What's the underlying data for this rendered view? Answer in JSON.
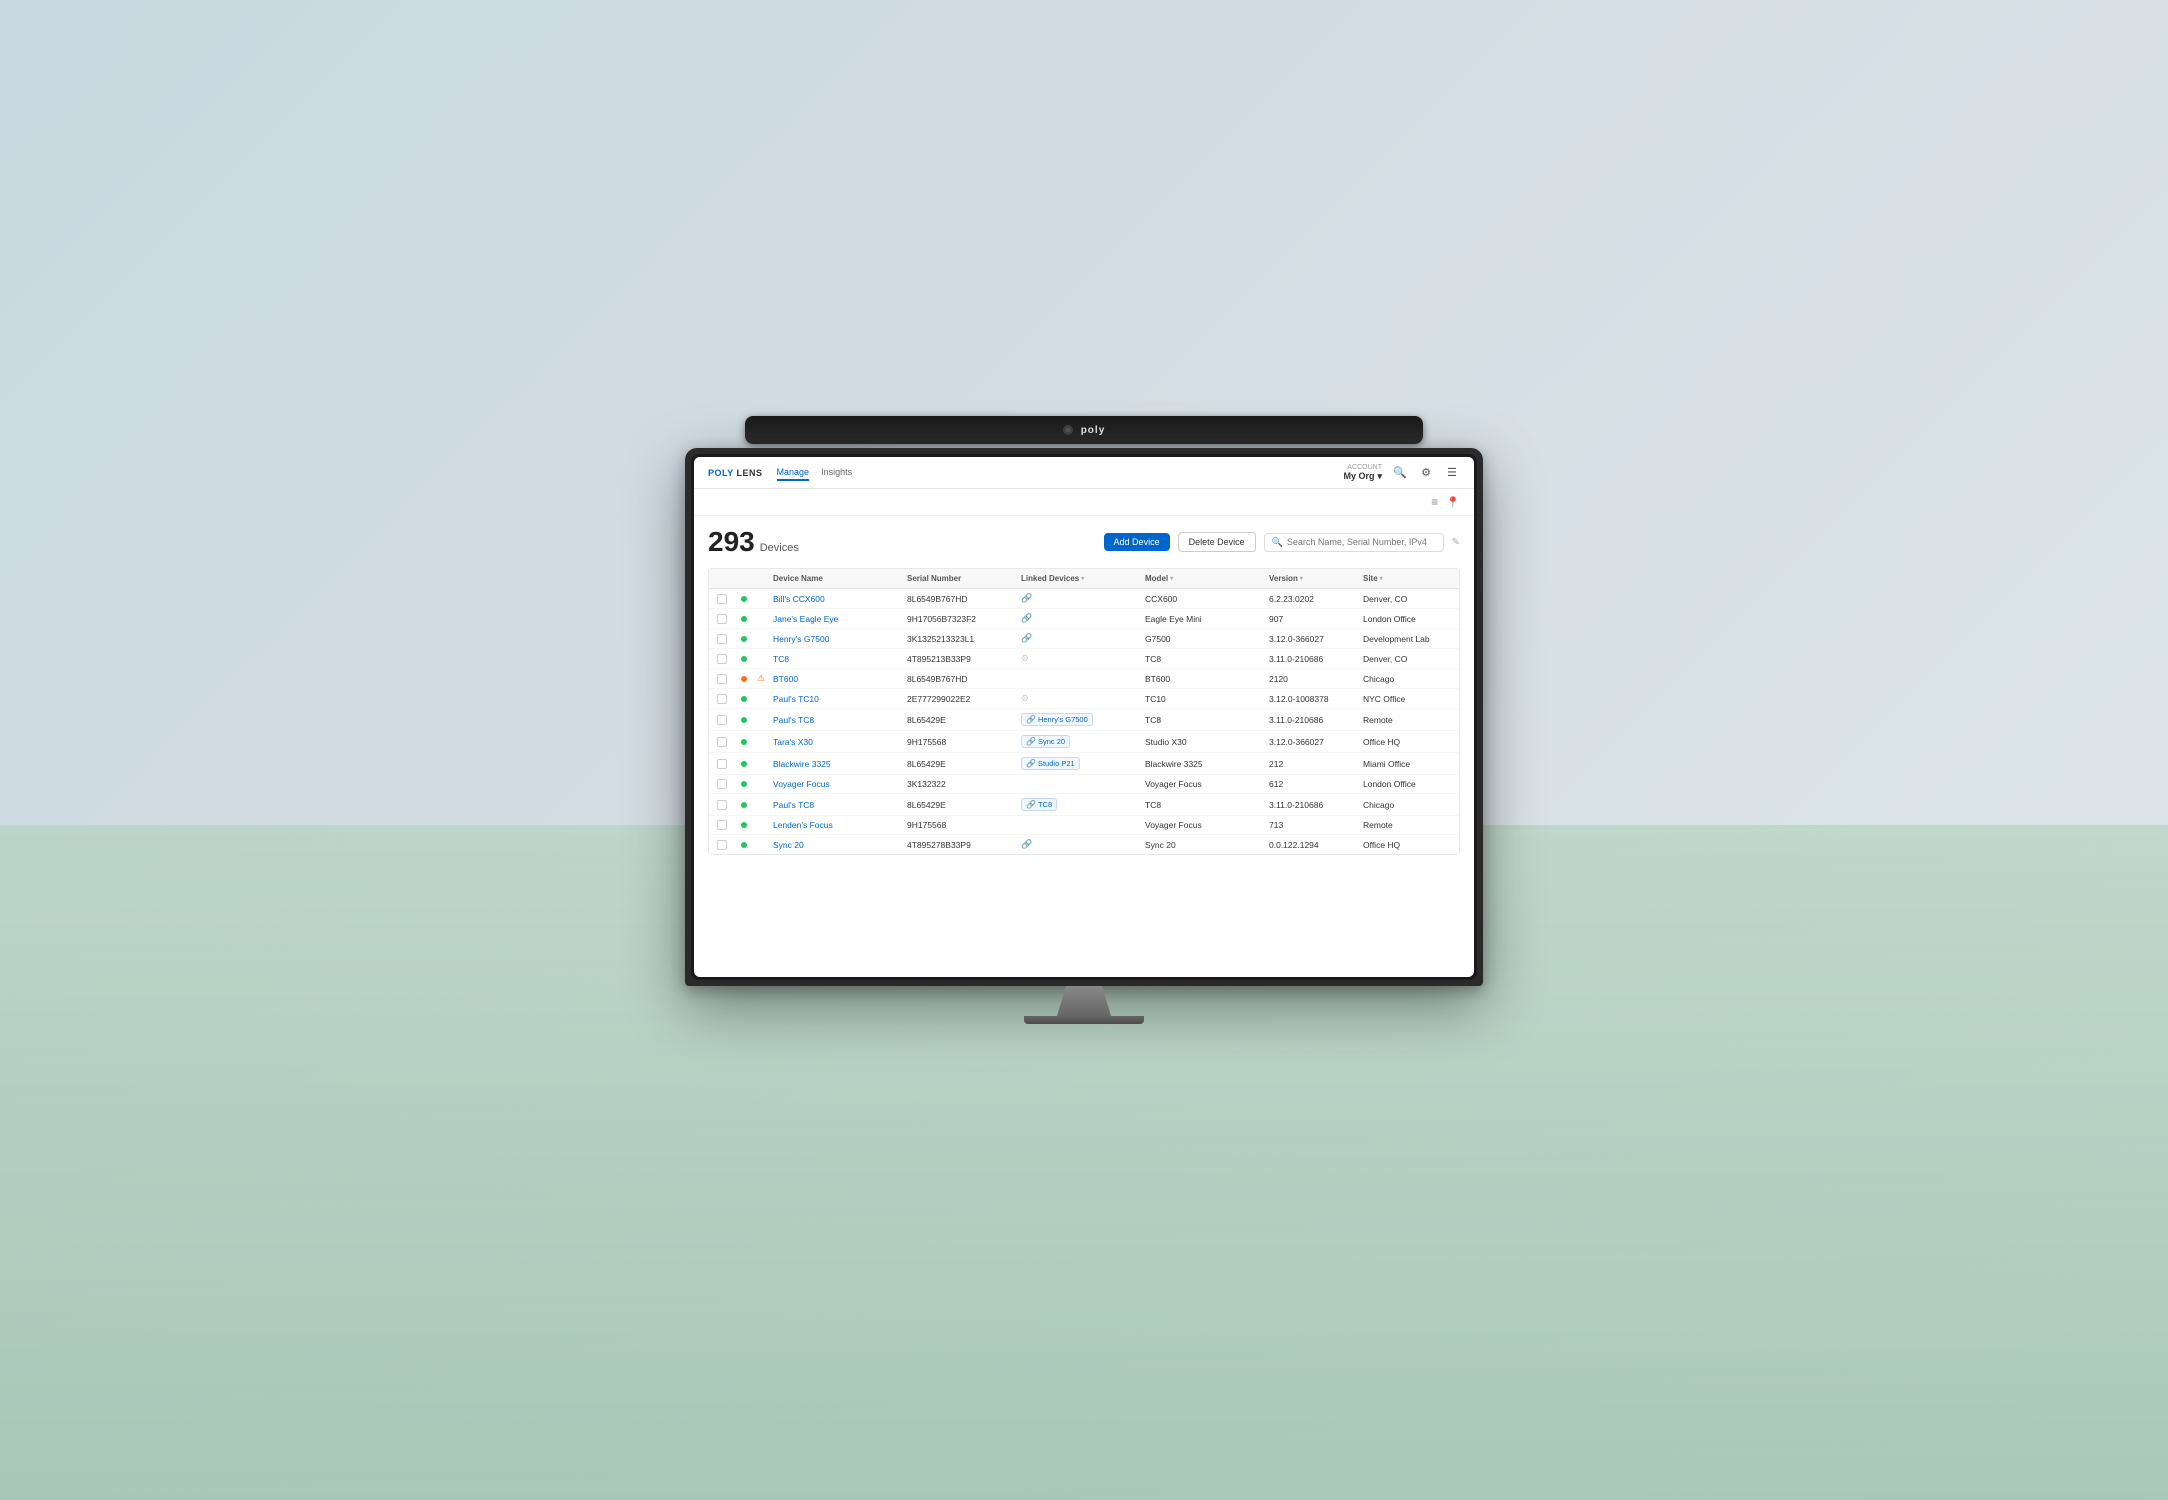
{
  "app": {
    "logo": "POLY LENS",
    "nav_tabs": [
      {
        "label": "Manage",
        "active": true
      },
      {
        "label": "Insights",
        "active": false
      }
    ],
    "account": {
      "label": "ACCOUNT",
      "name": "My Org",
      "chevron": "▾"
    },
    "nav_icons": {
      "search": "🔍",
      "settings": "⚙",
      "menu": "☰"
    }
  },
  "toolbar": {
    "filter_icon": "≡",
    "location_icon": "📍"
  },
  "page": {
    "device_count": "293",
    "device_label": "Devices",
    "add_button": "Add Device",
    "delete_button": "Delete Device",
    "search_placeholder": "Search Name, Serial Number, IPv4"
  },
  "table": {
    "columns": [
      {
        "id": "checkbox",
        "label": ""
      },
      {
        "id": "status",
        "label": ""
      },
      {
        "id": "alert",
        "label": ""
      },
      {
        "id": "device_name",
        "label": "Device Name"
      },
      {
        "id": "serial",
        "label": "Serial Number"
      },
      {
        "id": "linked",
        "label": "Linked Devices"
      },
      {
        "id": "model",
        "label": "Model"
      },
      {
        "id": "version",
        "label": "Version"
      },
      {
        "id": "site",
        "label": "Site"
      }
    ],
    "rows": [
      {
        "status": "green",
        "alert": false,
        "name": "Bill's CCX600",
        "serial": "8L6549B767HD",
        "linked": "",
        "linked_icon": "🔗",
        "model": "CCX600",
        "version": "6.2.23.0202",
        "site": "Denver, CO"
      },
      {
        "status": "green",
        "alert": false,
        "name": "Jane's Eagle Eye",
        "serial": "9H17056B7323F2",
        "linked": "",
        "linked_icon": "🔗",
        "model": "Eagle Eye Mini",
        "version": "907",
        "site": "London Office"
      },
      {
        "status": "green",
        "alert": false,
        "name": "Henry's G7500",
        "serial": "3K1325213323L1",
        "linked": "",
        "linked_icon": "🔗",
        "model": "G7500",
        "version": "3.12.0-366027",
        "site": "Development Lab"
      },
      {
        "status": "green",
        "alert": false,
        "name": "TC8",
        "serial": "4T895213B33P9",
        "linked": "",
        "linked_icon": "⚙",
        "model": "TC8",
        "version": "3.11.0-210686",
        "site": "Denver, CO"
      },
      {
        "status": "orange",
        "alert": true,
        "name": "BT600",
        "serial": "8L6549B767HD",
        "linked": "",
        "linked_icon": "",
        "model": "BT600",
        "version": "2120",
        "site": "Chicago"
      },
      {
        "status": "green",
        "alert": false,
        "name": "Paul's TC10",
        "serial": "2E777299022E2",
        "linked": "",
        "linked_icon": "⚙",
        "model": "TC10",
        "version": "3.12.0-1008378",
        "site": "NYC Office"
      },
      {
        "status": "green",
        "alert": false,
        "name": "Paul's TC8",
        "serial": "8L65429E",
        "linked": "Henry's G7500",
        "linked_icon": "🔗",
        "model": "TC8",
        "version": "3.11.0-210686",
        "site": "Remote"
      },
      {
        "status": "green",
        "alert": false,
        "name": "Tara's X30",
        "serial": "9H175568",
        "linked": "Sync 20",
        "linked_icon": "🔗",
        "model": "Studio X30",
        "version": "3.12.0-366027",
        "site": "Office HQ"
      },
      {
        "status": "green",
        "alert": false,
        "name": "Blackwire 3325",
        "serial": "8L65429E",
        "linked": "Studio P21",
        "linked_icon": "🔗",
        "model": "Blackwire 3325",
        "version": "212",
        "site": "Miami Office"
      },
      {
        "status": "green",
        "alert": false,
        "name": "Voyager Focus",
        "serial": "3K132322",
        "linked": "",
        "linked_icon": "",
        "model": "Voyager Focus",
        "version": "612",
        "site": "London Office"
      },
      {
        "status": "green",
        "alert": false,
        "name": "Paul's TC8",
        "serial": "8L65429E",
        "linked": "TC8",
        "linked_icon": "🔗",
        "model": "TC8",
        "version": "3.11.0-210686",
        "site": "Chicago"
      },
      {
        "status": "green",
        "alert": false,
        "name": "Lenden's Focus",
        "serial": "9H175568",
        "linked": "",
        "linked_icon": "",
        "model": "Voyager Focus",
        "version": "713",
        "site": "Remote"
      },
      {
        "status": "green",
        "alert": false,
        "name": "Sync 20",
        "serial": "4T895278B33P9",
        "linked": "",
        "linked_icon": "🔗",
        "model": "Sync 20",
        "version": "0.0.122.1294",
        "site": "Office HQ"
      }
    ]
  }
}
